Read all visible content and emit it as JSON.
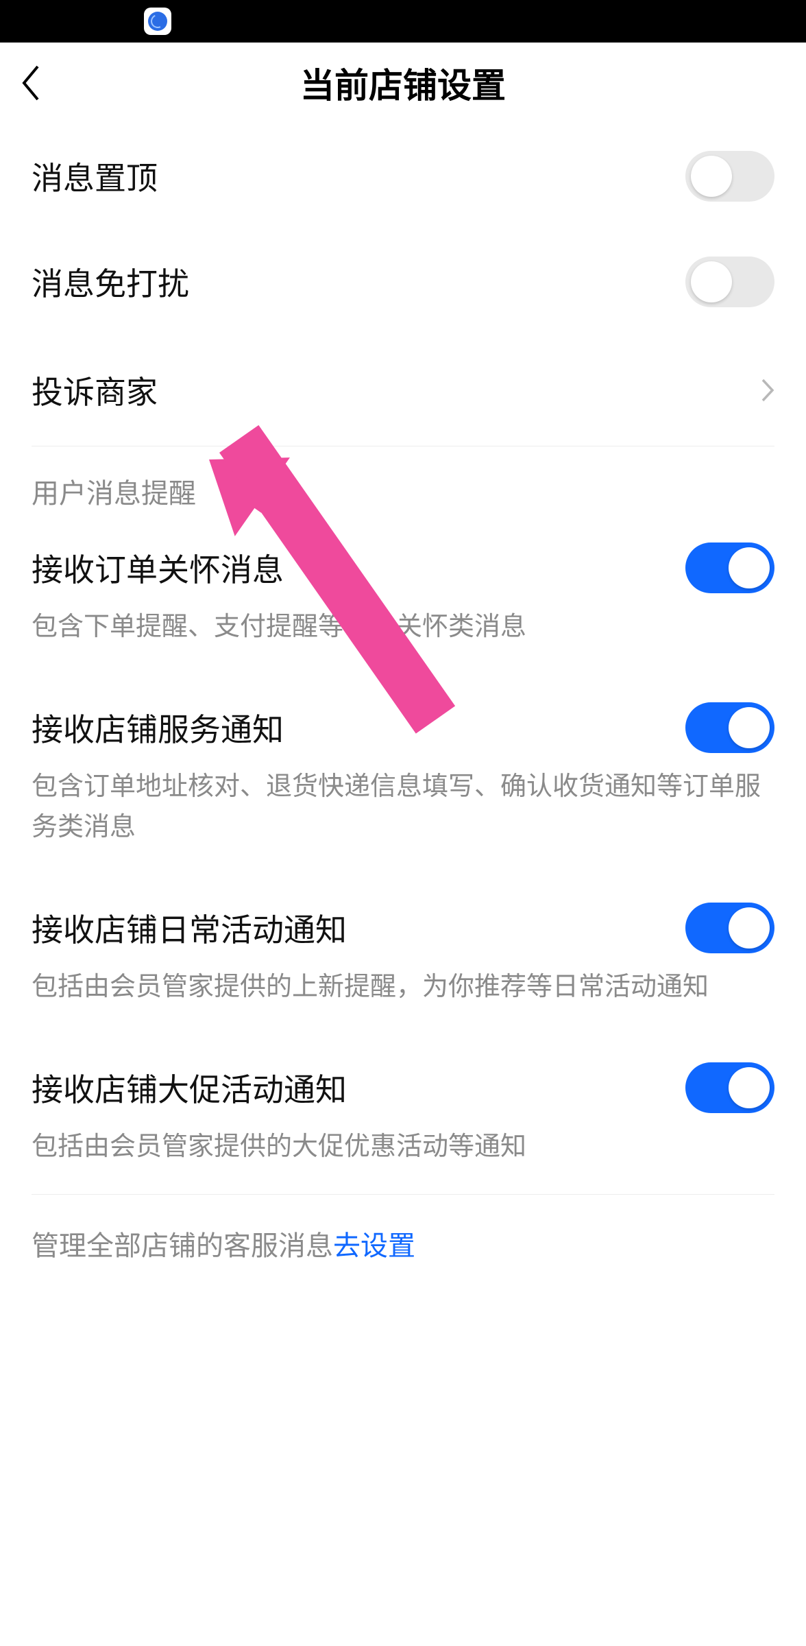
{
  "statusbar": {
    "app_icon": "globe-app-icon"
  },
  "nav": {
    "title": "当前店铺设置"
  },
  "switches": {
    "pin": {
      "label": "消息置顶",
      "on": false
    },
    "dnd": {
      "label": "消息免打扰",
      "on": false
    }
  },
  "complain": {
    "label": "投诉商家"
  },
  "section1_title": "用户消息提醒",
  "notif": {
    "order_care": {
      "label": "接收订单关怀消息",
      "desc": "包含下单提醒、支付提醒等订单关怀类消息",
      "on": true
    },
    "service": {
      "label": "接收店铺服务通知",
      "desc": "包含订单地址核对、退货快递信息填写、确认收货通知等订单服务类消息",
      "on": true
    },
    "daily": {
      "label": "接收店铺日常活动通知",
      "desc": "包括由会员管家提供的上新提醒，为你推荐等日常活动通知",
      "on": true
    },
    "promo": {
      "label": "接收店铺大促活动通知",
      "desc": "包括由会员管家提供的大促优惠活动等通知",
      "on": true
    }
  },
  "footer": {
    "prefix": "管理全部店铺的客服消息",
    "link": "去设置"
  },
  "annotation": {
    "type": "pink-arrow"
  }
}
